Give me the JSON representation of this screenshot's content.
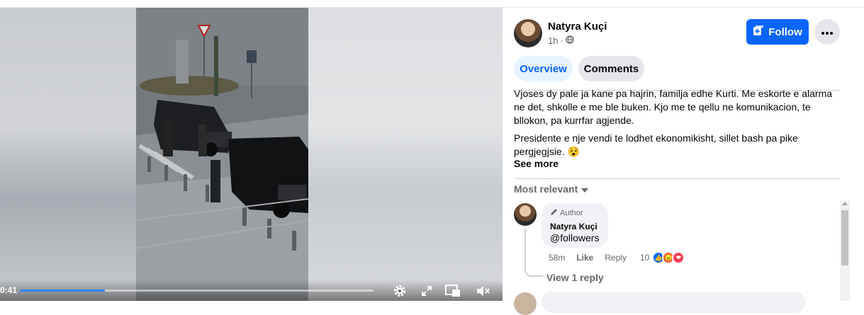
{
  "video": {
    "time": "0:41",
    "progress": 0.24,
    "icons": [
      "gear-icon",
      "fullscreen-icon",
      "miniplayer-icon",
      "mute-icon"
    ]
  },
  "post": {
    "author": "Natyra Kuçi",
    "time": "1h",
    "privacy_icon": "globe-icon",
    "follow_label": "Follow",
    "more_icon": "ellipsis-icon",
    "tabs": [
      {
        "label": "Overview",
        "active": true
      },
      {
        "label": "Comments",
        "active": false
      }
    ],
    "paragraphs": [
      "Vjoses dy pale ja kane pa hajrin, familja edhe Kurti. Me eskorte e alarma ne det, shkolle e me ble buken. Kjo me te qellu ne komunikacion, te bllokon, pa kurrfar agjende.",
      "Presidente e nje vendi te lodhet ekonomikisht, sillet bash pa pike pergjegjsie. 😵"
    ],
    "see_more": "See more"
  },
  "comments": {
    "sort_label": "Most relevant",
    "items": [
      {
        "badge": "Author",
        "name": "Natyra Kuçi",
        "text": "@followers",
        "time": "58m",
        "like": "Like",
        "reply": "Reply",
        "reaction_count": "10",
        "reactions": [
          "like",
          "angry",
          "love"
        ]
      }
    ],
    "view_replies": "View 1 reply"
  },
  "colors": {
    "accent": "#0866ff",
    "tab_active_bg": "#e7f3ff",
    "muted": "#65676b"
  }
}
